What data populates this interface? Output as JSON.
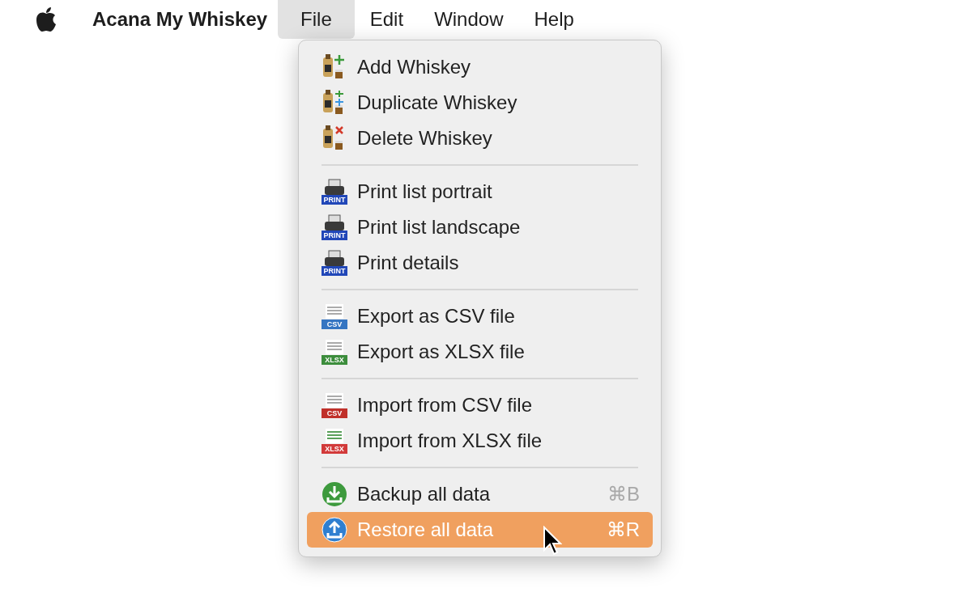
{
  "menu_bar": {
    "app_name": "Acana My Whiskey",
    "menus": [
      {
        "label": "File",
        "selected": true
      },
      {
        "label": "Edit",
        "selected": false
      },
      {
        "label": "Window",
        "selected": false
      },
      {
        "label": "Help",
        "selected": false
      }
    ]
  },
  "menu": {
    "sections": [
      [
        {
          "label": "Add Whiskey",
          "kind": "add",
          "selected": false
        },
        {
          "label": "Duplicate Whiskey",
          "kind": "duplicate",
          "selected": false
        },
        {
          "label": "Delete Whiskey",
          "kind": "delete",
          "selected": false
        }
      ],
      [
        {
          "label": "Print list portrait",
          "kind": "print",
          "badge": "PRINT",
          "selected": false
        },
        {
          "label": "Print list landscape",
          "kind": "print",
          "badge": "PRINT",
          "selected": false
        },
        {
          "label": "Print details",
          "kind": "print",
          "badge": "PRINT",
          "selected": false
        }
      ],
      [
        {
          "label": "Export as CSV file",
          "kind": "export",
          "badge": "CSV",
          "selected": false
        },
        {
          "label": "Export as XLSX file",
          "kind": "export-xlsx",
          "badge": "XLSX",
          "selected": false
        }
      ],
      [
        {
          "label": "Import from CSV file",
          "kind": "import",
          "badge": "CSV",
          "selected": false
        },
        {
          "label": "Import from XLSX file",
          "kind": "import-xlsx",
          "badge": "XLSX",
          "selected": false
        }
      ],
      [
        {
          "label": "Backup all data",
          "kind": "backup",
          "shortcut": "⌘B",
          "selected": false
        },
        {
          "label": "Restore all data",
          "kind": "restore",
          "shortcut": "⌘R",
          "selected": true
        }
      ]
    ]
  }
}
